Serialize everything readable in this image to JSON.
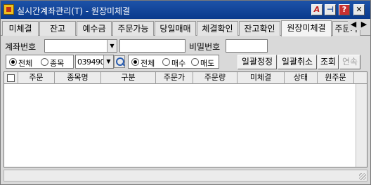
{
  "window": {
    "title": "실시간계좌관리(T) - 원장미체결",
    "buttons": {
      "a": "A",
      "pin": "⊣",
      "help": "?",
      "close": "✕"
    }
  },
  "tabs": [
    {
      "label": "미체결"
    },
    {
      "label": "잔고"
    },
    {
      "label": "예수금"
    },
    {
      "label": "주문가능"
    },
    {
      "label": "당일매매"
    },
    {
      "label": "체결확인"
    },
    {
      "label": "잔고확인"
    },
    {
      "label": "원장미체결",
      "active": true
    },
    {
      "label": "주문가"
    }
  ],
  "tab_arrows": {
    "left": "◀",
    "right": "▶"
  },
  "query": {
    "account_label": "계좌번호",
    "account_value": "",
    "account_name_value": "",
    "password_label": "비밀번호",
    "password_value": "",
    "scope_radio": {
      "all": "전체",
      "stock": "종목",
      "selected": "all"
    },
    "stock_code": "039490",
    "side_radio": {
      "all": "전체",
      "buy": "매수",
      "sell": "매도",
      "selected": "all"
    },
    "buttons": {
      "bulk_amend": "일괄정정",
      "bulk_cancel": "일괄취소",
      "inquiry": "조회",
      "continue": "연속"
    }
  },
  "grid": {
    "columns": [
      "주문",
      "종목명",
      "구분",
      "주문가",
      "주문량",
      "미체결",
      "상태",
      "원주문"
    ],
    "rows": []
  }
}
